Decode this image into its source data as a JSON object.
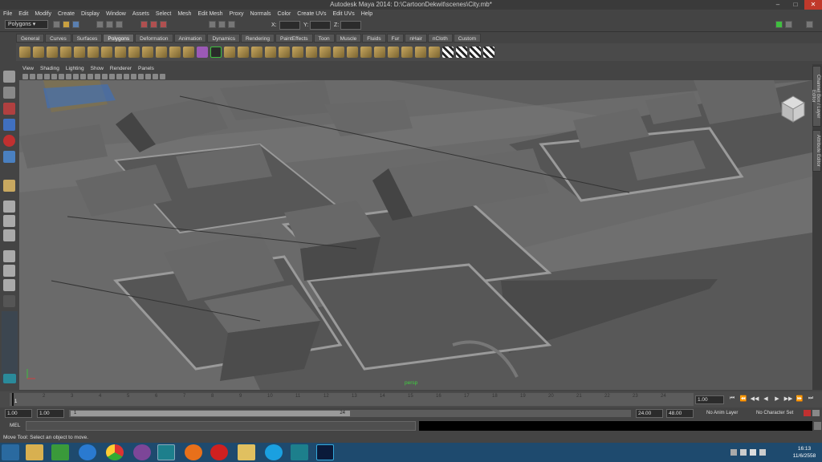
{
  "window": {
    "title": "Autodesk Maya 2014: D:\\CartoonDekwit\\scenes\\City.mb*",
    "controls": [
      "–",
      "□",
      "✕"
    ]
  },
  "menubar": [
    "File",
    "Edit",
    "Modify",
    "Create",
    "Display",
    "Window",
    "Assets",
    "Select",
    "Mesh",
    "Edit Mesh",
    "Proxy",
    "Normals",
    "Color",
    "Create UVs",
    "Edit UVs",
    "Help"
  ],
  "status_line": {
    "mode": "Polygons",
    "x_label": "X:",
    "y_label": "Y:",
    "z_label": "Z:"
  },
  "shelf_tabs": [
    "General",
    "Curves",
    "Surfaces",
    "Polygons",
    "Deformation",
    "Animation",
    "Dynamics",
    "Rendering",
    "PaintEffects",
    "Toon",
    "Muscle",
    "Fluids",
    "Fur",
    "nHair",
    "nCloth",
    "Custom"
  ],
  "active_shelf_tab": "Polygons",
  "panel_menu": [
    "View",
    "Shading",
    "Lighting",
    "Show",
    "Renderer",
    "Panels"
  ],
  "viewport": {
    "camera_label": "persp"
  },
  "side_tabs": [
    "Channel Box / Layer Editor",
    "Attribute Editor"
  ],
  "time_slider": {
    "ticks": [
      "1",
      "2",
      "3",
      "4",
      "5",
      "6",
      "7",
      "8",
      "9",
      "10",
      "11",
      "12",
      "13",
      "14",
      "15",
      "16",
      "17",
      "18",
      "19",
      "20",
      "21",
      "22",
      "23",
      "24"
    ],
    "current_frame": "1.00",
    "playback_buttons": [
      "⏮",
      "⏪",
      "◀◀",
      "◀",
      "▶",
      "▶▶",
      "⏩",
      "⏭"
    ]
  },
  "range_slider": {
    "start_time": "1.00",
    "playback_start": "1.00",
    "range_start_label": "1",
    "range_end_label": "24",
    "playback_end": "24.00",
    "end_time": "48.00",
    "anim_layer": "No Anim Layer",
    "character_set": "No Character Set"
  },
  "command_line": {
    "label": "MEL"
  },
  "help_line": {
    "text": "Move Tool: Select an object to move."
  },
  "taskbar": {
    "time": "16:13",
    "date": "11/6/2558",
    "apps": [
      "start",
      "explorer",
      "store",
      "ie",
      "chrome",
      "tor",
      "maya",
      "firefox",
      "app3",
      "folder",
      "skype",
      "maya2",
      "photoshop"
    ]
  }
}
